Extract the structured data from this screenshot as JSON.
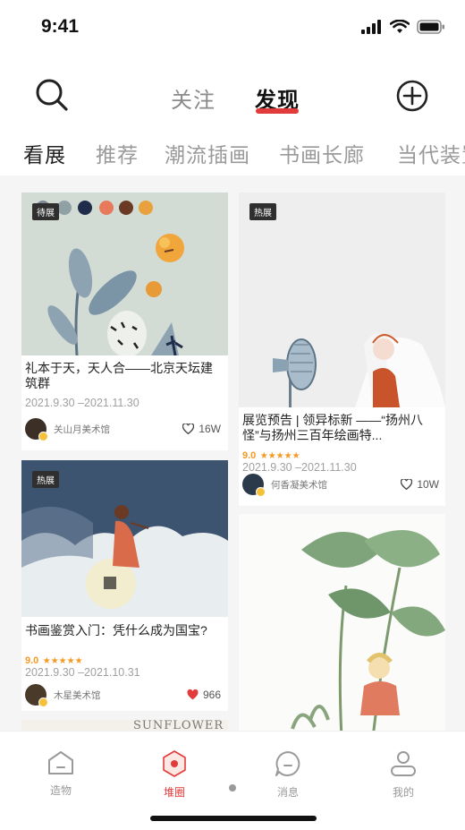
{
  "status_bar": {
    "time": "9:41"
  },
  "top_nav": {
    "follow": "关注",
    "discover": "发现"
  },
  "categories": [
    "看展",
    "推荐",
    "潮流插画",
    "书画长廊",
    "当代装置"
  ],
  "cards": [
    {
      "badge": "待展",
      "title": "礼本于天，天人合——北京天坛建筑群",
      "date": "2021.9.30 –2021.11.30",
      "author": "关山月美术馆",
      "likes": "16W",
      "liked": false
    },
    {
      "badge": "热展",
      "title": "展览预告 | 领异标新 ——“扬州八怪”与扬州三百年绘画特...",
      "rating": "9.0",
      "date": "2021.9.30 –2021.11.30",
      "author": "何香凝美术馆",
      "likes": "10W",
      "liked": false
    },
    {
      "badge": "热展",
      "title": "书画鉴赏入门：凭什么成为国宝?",
      "rating": "9.0",
      "date": "2021.9.30 –2021.10.31",
      "author": "木星美术馆",
      "likes": "966",
      "liked": true
    }
  ],
  "peek_card_text": "SUNFLOWER",
  "bottom_nav": [
    {
      "label": "造物",
      "icon": "home-icon"
    },
    {
      "label": "堆圈",
      "icon": "circle-hex-icon",
      "active": true
    },
    {
      "label": "消息",
      "icon": "message-icon"
    },
    {
      "label": "我的",
      "icon": "profile-icon"
    }
  ],
  "colors": {
    "accent": "#e23b3b",
    "star": "#f59a23"
  }
}
